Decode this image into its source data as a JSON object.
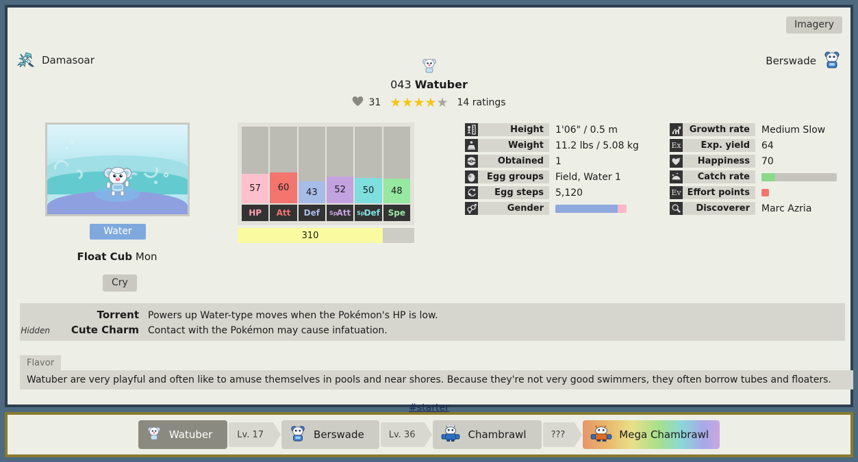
{
  "nav": {
    "prev_label": "Damasoar",
    "next_label": "Berswade",
    "imagery_label": "Imagery"
  },
  "header": {
    "dex_number": "043",
    "name": "Watuber",
    "favorites_count": "31",
    "stars_filled": 4,
    "stars_total": 5,
    "ratings_label": "14 ratings"
  },
  "left": {
    "type_label": "Water",
    "species_name": "Float Cub",
    "species_suffix": "Mon",
    "cry_label": "Cry"
  },
  "stats": {
    "total_label": "310",
    "total_value": 310,
    "max_stat": 255,
    "entries": [
      {
        "label": "HP",
        "sp": "",
        "value": 57,
        "color": "#ffc0cb"
      },
      {
        "label": "Att",
        "sp": "",
        "value": 60,
        "color": "#f4746e"
      },
      {
        "label": "Def",
        "sp": "",
        "value": 43,
        "color": "#a8bce8"
      },
      {
        "label": "Att",
        "sp": "Sp",
        "value": 52,
        "color": "#c3a2e0"
      },
      {
        "label": "Def",
        "sp": "Sp",
        "value": 50,
        "color": "#7fdede"
      },
      {
        "label": "Spe",
        "sp": "",
        "value": 48,
        "color": "#97e8a0"
      }
    ],
    "label_colors": [
      "#ff9fb0",
      "#f4746e",
      "#a8bce8",
      "#c3a2e0",
      "#7fdede",
      "#97e8a0"
    ]
  },
  "info_left": [
    {
      "icon": "height-ruler-icon",
      "label": "Height",
      "value": "1'06\" / 0.5 m",
      "type": "text"
    },
    {
      "icon": "weight-scale-icon",
      "label": "Weight",
      "value": "11.2 lbs / 5.08 kg",
      "type": "text"
    },
    {
      "icon": "pokeball-icon",
      "label": "Obtained",
      "value": "1",
      "type": "text"
    },
    {
      "icon": "egg-icon",
      "label": "Egg groups",
      "value": "Field, Water 1",
      "type": "text"
    },
    {
      "icon": "egg-steps-icon",
      "label": "Egg steps",
      "value": "5,120",
      "type": "text"
    },
    {
      "icon": "gender-icon",
      "label": "Gender",
      "value": "",
      "type": "genderbar",
      "male_pct": 87.5,
      "female_pct": 12.5,
      "male_color": "#8fa8dd",
      "female_color": "#ffb6c8"
    }
  ],
  "info_right": [
    {
      "icon": "growth-chart-icon",
      "label": "Growth rate",
      "value": "Medium Slow",
      "type": "text"
    },
    {
      "icon": "exp-icon",
      "label": "Exp. yield",
      "value": "64",
      "type": "text",
      "glyph": "Ex"
    },
    {
      "icon": "happiness-heart-icon",
      "label": "Happiness",
      "value": "70",
      "type": "text"
    },
    {
      "icon": "catch-rate-icon",
      "label": "Catch rate",
      "value": "",
      "type": "bar",
      "pct": 18,
      "color": "#8bd98b"
    },
    {
      "icon": "effort-points-icon",
      "label": "Effort points",
      "value": "",
      "type": "square",
      "glyph": "Ev",
      "color": "#f4746e"
    },
    {
      "icon": "discoverer-icon",
      "label": "Discoverer",
      "value": "Marc Azria",
      "type": "text"
    }
  ],
  "abilities": [
    {
      "hidden_label": "",
      "name": "Torrent",
      "desc": "Powers up Water-type moves when the Pokémon's HP is low."
    },
    {
      "hidden_label": "Hidden",
      "name": "Cute Charm",
      "desc": "Contact with the Pokémon may cause infatuation."
    }
  ],
  "flavor": {
    "tab_label": "Flavor",
    "text": "Watuber are very playful and often like to amuse themselves in pools and near shores. Because they're not very good swimmers, they often borrow tubes and floaters."
  },
  "tags": {
    "starter": "#starter"
  },
  "evolution": [
    {
      "kind": "node",
      "name": "Watuber",
      "state": "active"
    },
    {
      "kind": "arrow",
      "name": "Lv. 17"
    },
    {
      "kind": "node",
      "name": "Berswade",
      "state": "normal"
    },
    {
      "kind": "arrow",
      "name": "Lv. 36"
    },
    {
      "kind": "node",
      "name": "Chambrawl",
      "state": "normal"
    },
    {
      "kind": "arrow",
      "name": "???"
    },
    {
      "kind": "node",
      "name": "Mega Chambrawl",
      "state": "mega"
    }
  ],
  "colors": {
    "frame_outer": "#4d6a80",
    "frame_inner": "#2e3f4f",
    "evo_frame": "#8a7a2e",
    "page_bg": "#edefe6",
    "panel": "#d6d6ce",
    "star_on": "#f5c518",
    "star_off": "#a8a8a0",
    "type_water": "#7fa9dd"
  }
}
